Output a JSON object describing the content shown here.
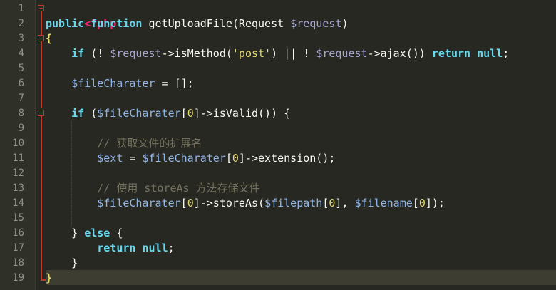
{
  "editor": {
    "colors": {
      "background": "#272822",
      "gutter": "#2f3129",
      "current_line": "#3e3d32",
      "fold_marker": "#c0392b"
    },
    "line_numbers": [
      "1",
      "2",
      "3",
      "4",
      "5",
      "6",
      "7",
      "8",
      "9",
      "10",
      "11",
      "12",
      "13",
      "14",
      "15",
      "16",
      "17",
      "18",
      "19"
    ],
    "code": {
      "l1": {
        "t0": "<?php"
      },
      "l2": {
        "t0": "public",
        "t1": " ",
        "t2": "function",
        "t3": " getUploadFile(Request ",
        "t4": "$request",
        "t5": ")"
      },
      "l3": {
        "t0": "{"
      },
      "l4": {
        "t0": "    ",
        "t1": "if",
        "t2": " (! ",
        "t3": "$request",
        "t4": "->isMethod(",
        "t5": "'post'",
        "t6": ") || ! ",
        "t7": "$request",
        "t8": "->ajax()) ",
        "t9": "return",
        "t10": " ",
        "t11": "null",
        "t12": ";"
      },
      "l5": {
        "t0": ""
      },
      "l6": {
        "t0": "    ",
        "t1": "$fileCharater",
        "t2": " = [];"
      },
      "l7": {
        "t0": ""
      },
      "l8": {
        "t0": "    ",
        "t1": "if",
        "t2": " (",
        "t3": "$fileCharater",
        "t4": "[",
        "t5": "0",
        "t6": "]->isValid()) {"
      },
      "l9": {
        "t0": ""
      },
      "l10": {
        "t0": "        ",
        "t1": "// 获取文件的扩展名"
      },
      "l11": {
        "t0": "        ",
        "t1": "$ext",
        "t2": " = ",
        "t3": "$fileCharater",
        "t4": "[",
        "t5": "0",
        "t6": "]->extension();"
      },
      "l12": {
        "t0": ""
      },
      "l13": {
        "t0": "        ",
        "t1": "// 使用 storeAs 方法存储文件"
      },
      "l14": {
        "t0": "        ",
        "t1": "$fileCharater",
        "t2": "[",
        "t3": "0",
        "t4": "]->storeAs(",
        "t5": "$filepath",
        "t6": "[",
        "t7": "0",
        "t8": "], ",
        "t9": "$filename",
        "t10": "[",
        "t11": "0",
        "t12": "]);"
      },
      "l15": {
        "t0": ""
      },
      "l16": {
        "t0": "    } ",
        "t1": "else",
        "t2": " {"
      },
      "l17": {
        "t0": "        ",
        "t1": "return",
        "t2": " ",
        "t3": "null",
        "t4": ";"
      },
      "l18": {
        "t0": "    }"
      },
      "l19": {
        "t0": "}"
      }
    }
  }
}
